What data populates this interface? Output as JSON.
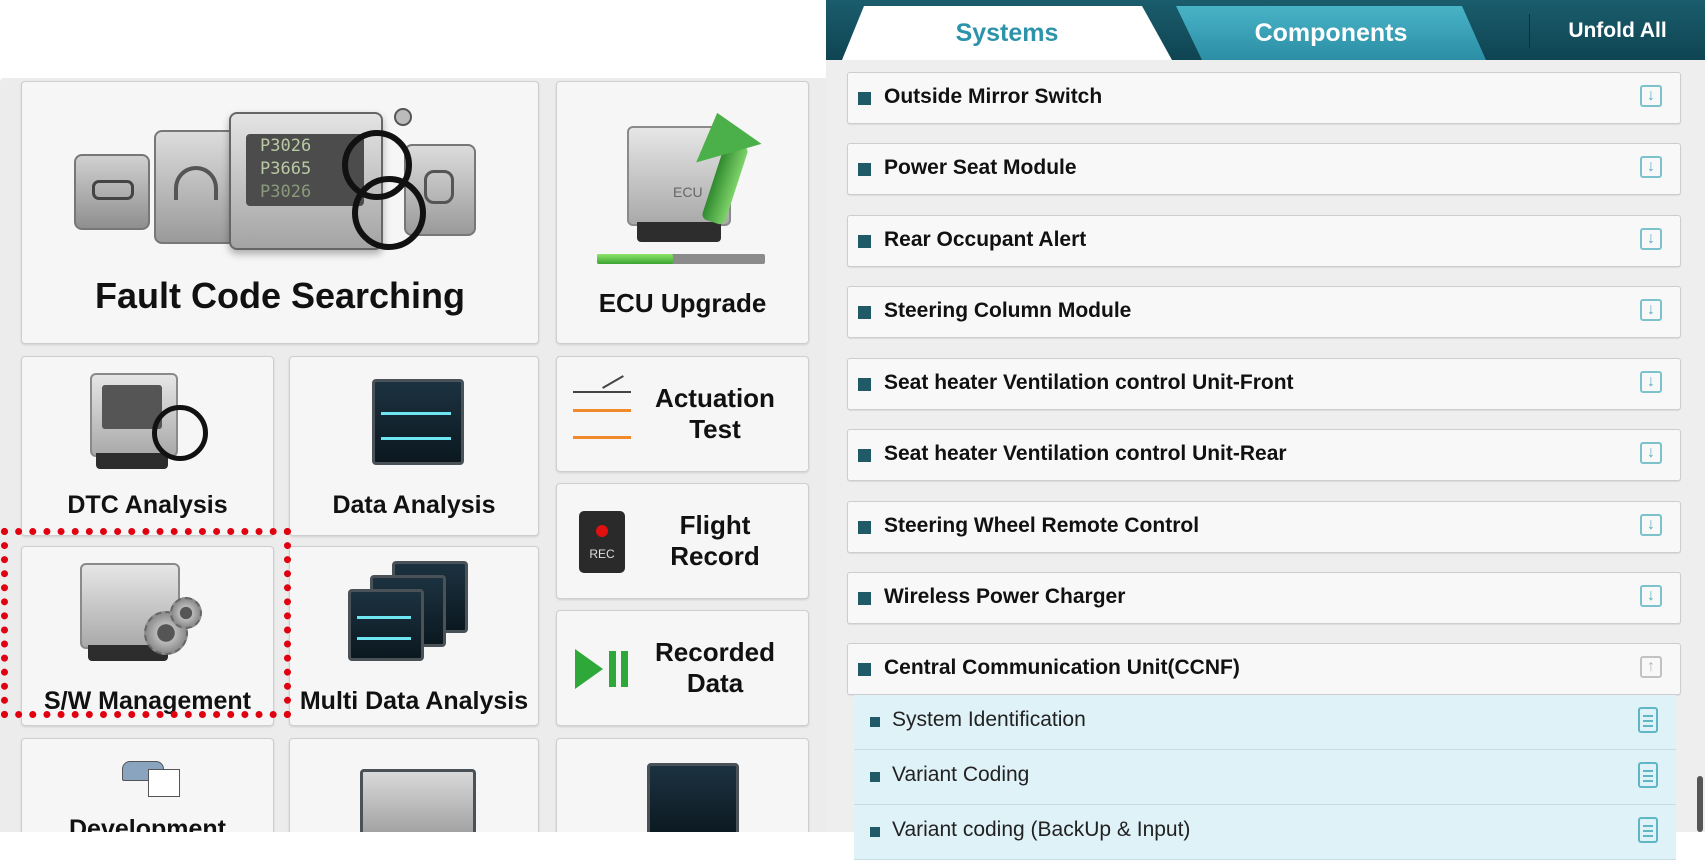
{
  "menu": {
    "fault_code_searching": "Fault Code Searching",
    "fault_codes": [
      "P3026",
      "P3665",
      "P3026"
    ],
    "ecu_upgrade": "ECU Upgrade",
    "ecu_badge": "ECU",
    "ecu_upgrade_progress": 0.45,
    "dtc_analysis": "DTC Analysis",
    "data_analysis": "Data Analysis",
    "actuation_test": "Actuation Test",
    "flight_record": "Flight Record",
    "rec_badge": "REC",
    "sw_management": "S/W Management",
    "multi_data_analysis": "Multi Data Analysis",
    "recorded_data": "Recorded Data",
    "development": "Development",
    "highlight_color": "#e00010"
  },
  "tabs": {
    "systems": "Systems",
    "components": "Components",
    "unfold_all": "Unfold All",
    "active": "Systems"
  },
  "systems": [
    {
      "name": "Outside Mirror Switch",
      "expanded": false
    },
    {
      "name": "Power Seat Module",
      "expanded": false
    },
    {
      "name": "Rear Occupant Alert",
      "expanded": false
    },
    {
      "name": "Steering Column Module",
      "expanded": false
    },
    {
      "name": "Seat heater Ventilation control Unit-Front",
      "expanded": false
    },
    {
      "name": "Seat heater Ventilation control Unit-Rear",
      "expanded": false
    },
    {
      "name": "Steering Wheel Remote Control",
      "expanded": false
    },
    {
      "name": "Wireless Power Charger",
      "expanded": false
    },
    {
      "name": "Central Communication Unit(CCNF)",
      "expanded": true
    }
  ],
  "ccnf_items": [
    "System Identification",
    "Variant Coding",
    "Variant coding (BackUp & Input)"
  ],
  "colors": {
    "tab_bar": "#1a5d6d",
    "tab_active_text": "#2d93ab",
    "bullet": "#1f5a66",
    "sub_row_bg": "#dff2f8"
  }
}
